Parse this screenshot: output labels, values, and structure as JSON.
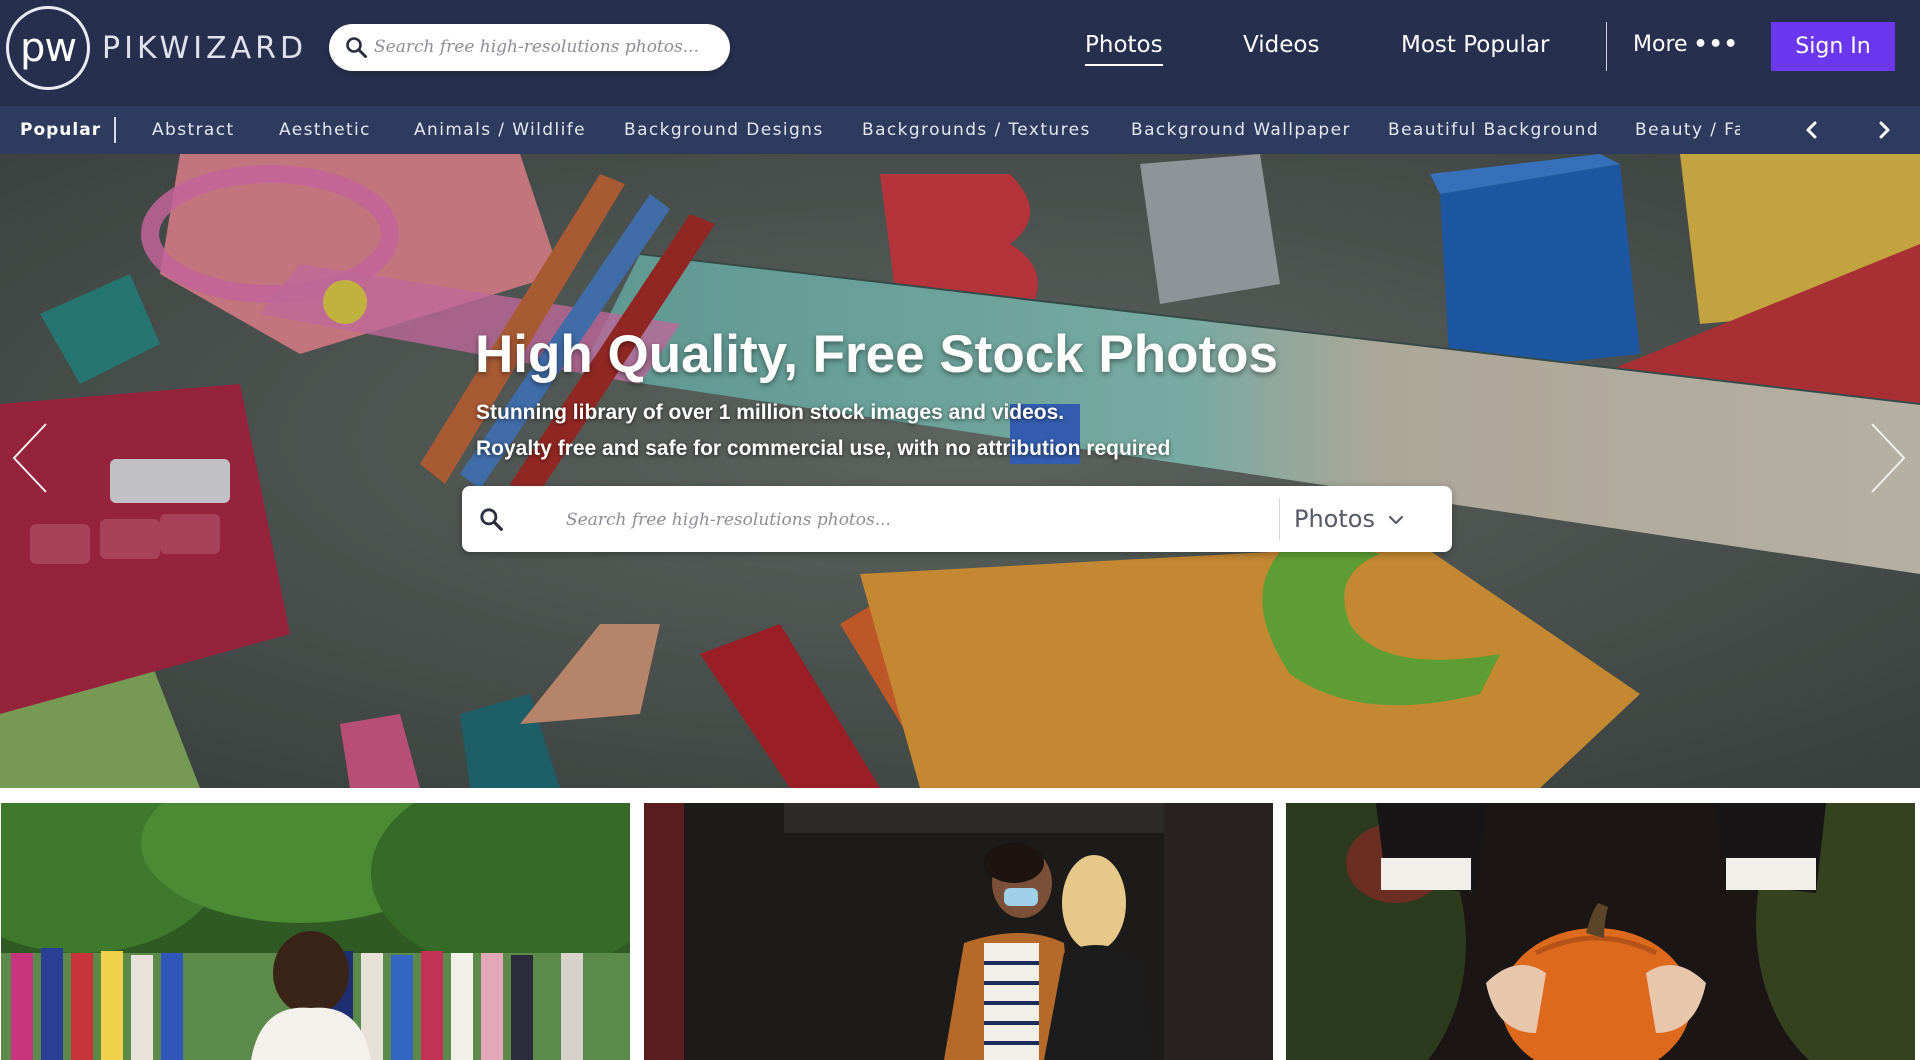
{
  "header": {
    "logo_mark": "pw",
    "logo_text": "PIKWIZARD",
    "search_placeholder": "Search free high-resolutions photos...",
    "nav": {
      "photos": "Photos",
      "videos": "Videos",
      "most_popular": "Most Popular",
      "more": "More",
      "more_icon": "ellipsis-icon"
    },
    "signin_label": "Sign In",
    "colors": {
      "bg": "#262f4e",
      "accent": "#6c37f0"
    }
  },
  "categories": {
    "items": [
      "Popular",
      "Abstract",
      "Aesthetic",
      "Animals / Wildlife",
      "Background Designs",
      "Backgrounds / Textures",
      "Background Wallpaper",
      "Beautiful Background",
      "Beauty / Fash"
    ],
    "prev_icon": "chevron-left-icon",
    "next_icon": "chevron-right-icon"
  },
  "hero": {
    "title": "High Quality, Free Stock Photos",
    "subtitle_1": "Stunning library of over 1 million stock images and videos.",
    "subtitle_2": "Royalty free and safe for commercial use, with no attribution required",
    "search_placeholder": "Search free high-resolutions photos...",
    "media_type": "Photos",
    "prev_icon": "chevron-left-icon",
    "next_icon": "chevron-right-icon"
  },
  "photos": [
    {
      "name": "wedding-photo"
    },
    {
      "name": "couple-masks-photo"
    },
    {
      "name": "pumpkin-photo"
    }
  ]
}
